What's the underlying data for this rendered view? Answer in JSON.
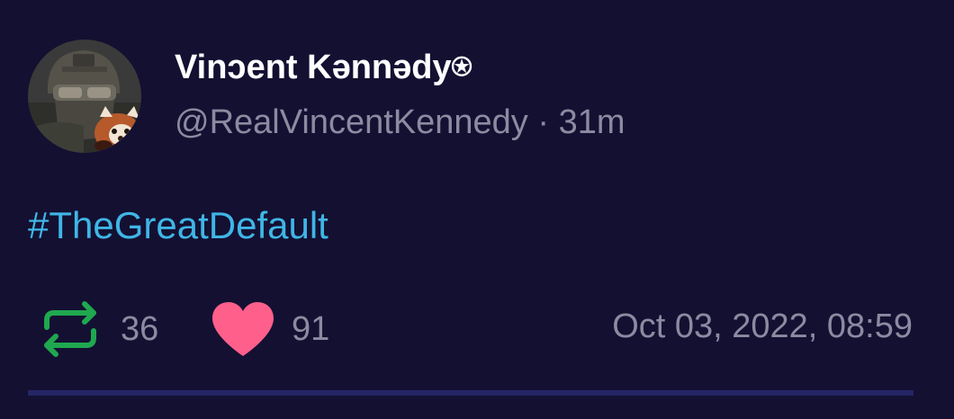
{
  "post": {
    "author_name": "Vinɔent Kənnədy⍟",
    "handle": "@RealVincentKennedy",
    "separator": "·",
    "time_ago": "31m",
    "hashtag": "#TheGreatDefault",
    "reposts": "36",
    "likes": "91",
    "timestamp": "Oct 03, 2022, 08:59"
  },
  "icons": {
    "repost": "repost-icon",
    "like": "heart-icon",
    "avatar": "avatar-photo"
  },
  "colors": {
    "background": "#141032",
    "hashtag": "#3fb6e6",
    "repost_icon": "#1fa84f",
    "heart_icon": "#ff5f8b",
    "muted_text": "#8d8aa1",
    "divider": "#242566"
  }
}
